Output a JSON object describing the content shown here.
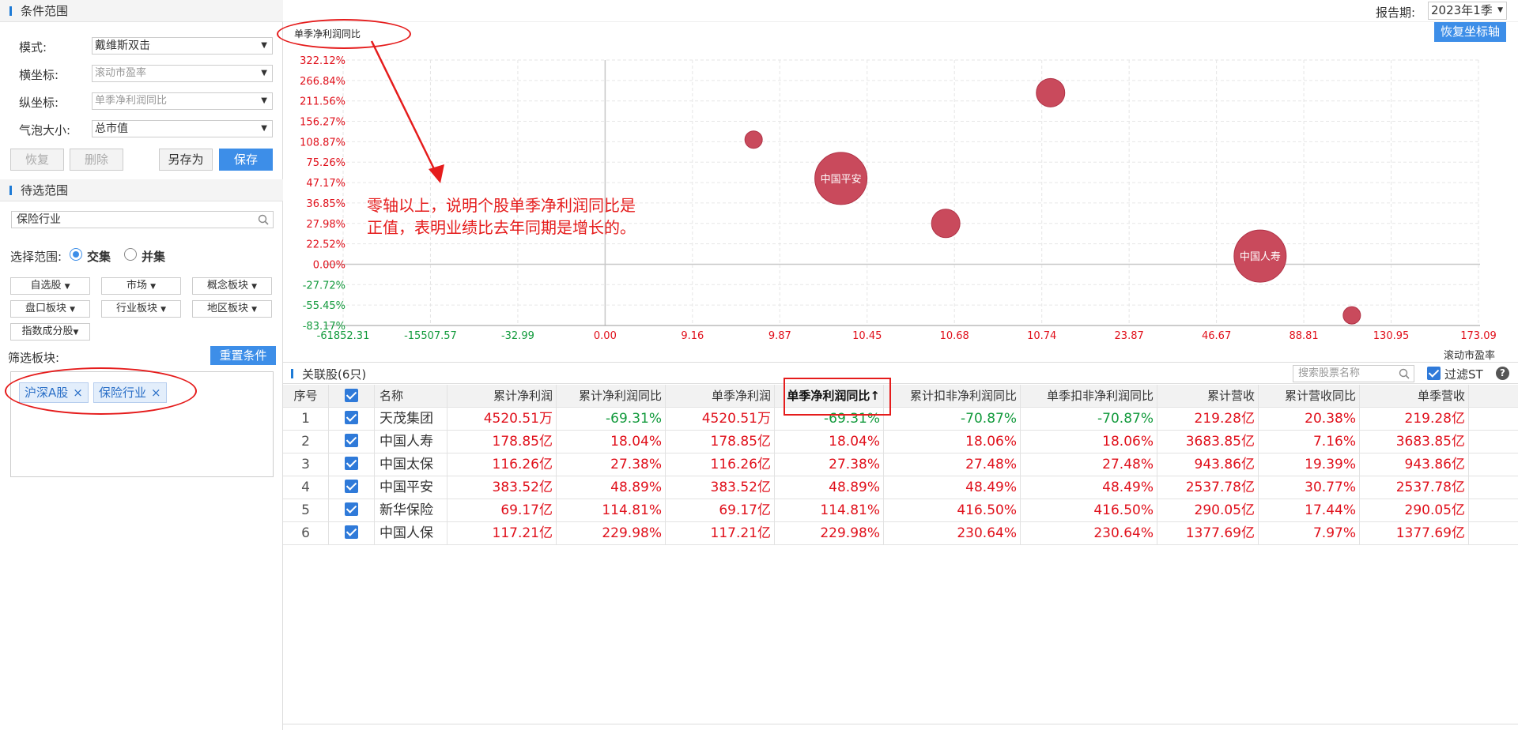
{
  "sidebar": {
    "condition_title": "条件范围",
    "mode_label": "模式:",
    "mode_value": "戴维斯双击",
    "x_label": "横坐标:",
    "x_value": "滚动市盈率",
    "y_label": "纵坐标:",
    "y_value": "单季净利润同比",
    "bubble_label": "气泡大小:",
    "bubble_value": "总市值",
    "btn_restore": "恢复",
    "btn_delete": "删除",
    "btn_saveas": "另存为",
    "btn_save": "保存",
    "candidate_title": "待选范围",
    "search_value": "保险行业",
    "scope_label": "选择范围:",
    "scope_intersect": "交集",
    "scope_union": "并集",
    "dd": [
      "自选股",
      "市场",
      "概念板块",
      "盘口板块",
      "行业板块",
      "地区板块",
      "指数成分股"
    ],
    "filter_label": "筛选板块:",
    "reset_btn": "重置条件",
    "tags": [
      "沪深A股",
      "保险行业"
    ]
  },
  "header": {
    "period_label": "报告期:",
    "period_value": "2023年1季",
    "reset_axis_btn": "恢复坐标轴"
  },
  "annotation": "零轴以上，说明个股单季净利润同比是正值，表明业绩比去年同期是增长的。",
  "annotation_lines": [
    "零轴以上，说明个股单季净利润同比是",
    "正值，表明业绩比去年同期是增长的。"
  ],
  "chart_data": {
    "type": "scatter",
    "ylabel": "单季净利润同比",
    "xlabel": "滚动市盈率",
    "y_ticks": [
      "322.12%",
      "266.84%",
      "211.56%",
      "156.27%",
      "108.87%",
      "75.26%",
      "47.17%",
      "36.85%",
      "27.98%",
      "22.52%",
      "0.00%",
      "-27.72%",
      "-55.45%",
      "-83.17%"
    ],
    "x_ticks": [
      "-61852.31",
      "-15507.57",
      "-32.99",
      "0.00",
      "9.16",
      "9.87",
      "10.45",
      "10.68",
      "10.74",
      "23.87",
      "46.67",
      "88.81",
      "130.95",
      "173.09"
    ],
    "scale": "non-linear (tick-indexed)",
    "grid": true,
    "bubbles": [
      {
        "label": "",
        "x_index": 4.7,
        "y_index": 3.9,
        "size": "small"
      },
      {
        "label": "中国平安",
        "x_index": 5.7,
        "y_index": 5.8,
        "size": "large"
      },
      {
        "label": "",
        "x_index": 6.9,
        "y_index": 8.0,
        "size": "medium"
      },
      {
        "label": "",
        "x_index": 8.1,
        "y_index": 1.6,
        "size": "medium"
      },
      {
        "label": "中国人寿",
        "x_index": 10.5,
        "y_index": 9.6,
        "size": "large"
      },
      {
        "label": "",
        "x_index": 11.55,
        "y_index": 12.5,
        "size": "small"
      }
    ],
    "bubble_color": "#c94a5c"
  },
  "table": {
    "title": "关联股(6只)",
    "search_placeholder": "搜索股票名称",
    "filter_st": "过滤ST",
    "help": "?",
    "headers": [
      "序号",
      "",
      "名称",
      "累计净利润",
      "累计净利润同比",
      "单季净利润",
      "单季净利润同比↑",
      "累计扣非净利润同比",
      "单季扣非净利润同比",
      "累计营收",
      "累计营收同比",
      "单季营收"
    ],
    "rows": [
      {
        "idx": "1",
        "name": "天茂集团",
        "cols": [
          "4520.51万",
          "-69.31%",
          "4520.51万",
          "-69.31%",
          "-70.87%",
          "-70.87%",
          "219.28亿",
          "20.38%",
          "219.28亿"
        ]
      },
      {
        "idx": "2",
        "name": "中国人寿",
        "cols": [
          "178.85亿",
          "18.04%",
          "178.85亿",
          "18.04%",
          "18.06%",
          "18.06%",
          "3683.85亿",
          "7.16%",
          "3683.85亿"
        ]
      },
      {
        "idx": "3",
        "name": "中国太保",
        "cols": [
          "116.26亿",
          "27.38%",
          "116.26亿",
          "27.38%",
          "27.48%",
          "27.48%",
          "943.86亿",
          "19.39%",
          "943.86亿"
        ]
      },
      {
        "idx": "4",
        "name": "中国平安",
        "cols": [
          "383.52亿",
          "48.89%",
          "383.52亿",
          "48.89%",
          "48.49%",
          "48.49%",
          "2537.78亿",
          "30.77%",
          "2537.78亿"
        ]
      },
      {
        "idx": "5",
        "name": "新华保险",
        "cols": [
          "69.17亿",
          "114.81%",
          "69.17亿",
          "114.81%",
          "416.50%",
          "416.50%",
          "290.05亿",
          "17.44%",
          "290.05亿"
        ]
      },
      {
        "idx": "6",
        "name": "中国人保",
        "cols": [
          "117.21亿",
          "229.98%",
          "117.21亿",
          "229.98%",
          "230.64%",
          "230.64%",
          "1377.69亿",
          "7.97%",
          "1377.69亿"
        ]
      }
    ]
  }
}
